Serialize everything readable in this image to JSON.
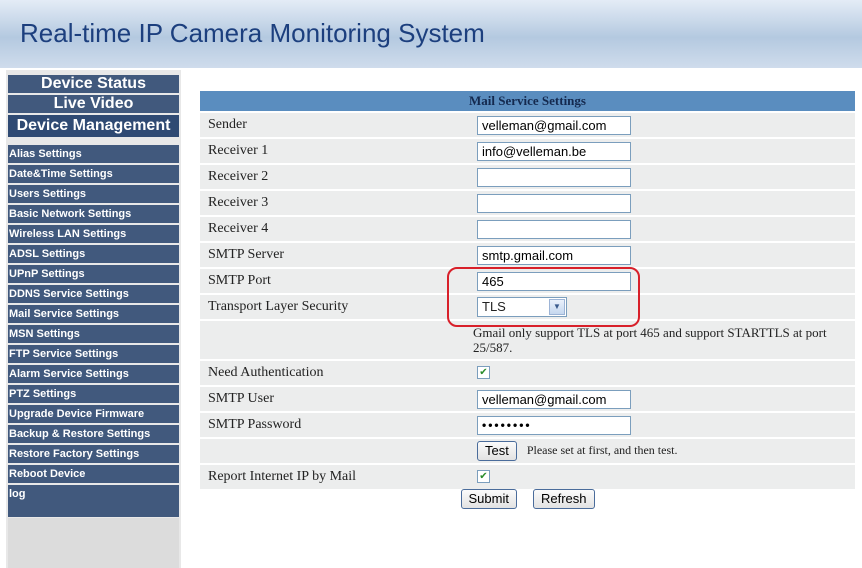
{
  "app_title": "Real-time IP Camera Monitoring System",
  "sidebar": {
    "top_items": [
      {
        "label": "Device Status"
      },
      {
        "label": "Live Video"
      },
      {
        "label": "Device Management"
      }
    ],
    "items": [
      {
        "label": "Alias Settings"
      },
      {
        "label": "Date&Time Settings"
      },
      {
        "label": "Users Settings"
      },
      {
        "label": "Basic Network Settings"
      },
      {
        "label": "Wireless LAN Settings"
      },
      {
        "label": "ADSL Settings"
      },
      {
        "label": "UPnP Settings"
      },
      {
        "label": "DDNS Service Settings"
      },
      {
        "label": "Mail Service Settings"
      },
      {
        "label": "MSN Settings"
      },
      {
        "label": "FTP Service Settings"
      },
      {
        "label": "Alarm Service Settings"
      },
      {
        "label": "PTZ Settings"
      },
      {
        "label": "Upgrade Device Firmware"
      },
      {
        "label": "Backup & Restore Settings"
      },
      {
        "label": "Restore Factory Settings"
      },
      {
        "label": "Reboot Device"
      },
      {
        "label": "log"
      }
    ]
  },
  "form": {
    "title": "Mail Service Settings",
    "sender": {
      "label": "Sender",
      "value": "velleman@gmail.com"
    },
    "receiver1": {
      "label": "Receiver 1",
      "value": "info@velleman.be"
    },
    "receiver2": {
      "label": "Receiver 2",
      "value": ""
    },
    "receiver3": {
      "label": "Receiver 3",
      "value": ""
    },
    "receiver4": {
      "label": "Receiver 4",
      "value": ""
    },
    "smtp_server": {
      "label": "SMTP Server",
      "value": "smtp.gmail.com"
    },
    "smtp_port": {
      "label": "SMTP Port",
      "value": "465"
    },
    "tls": {
      "label": "Transport Layer Security",
      "value": "TLS"
    },
    "gmail_note": "Gmail only support TLS at port 465 and support STARTTLS at port 25/587.",
    "need_auth": {
      "label": "Need Authentication",
      "checked": true
    },
    "smtp_user": {
      "label": "SMTP User",
      "value": "velleman@gmail.com"
    },
    "smtp_password": {
      "label": "SMTP Password",
      "value": "••••••••"
    },
    "test": {
      "label": "Test",
      "hint": "Please set at first, and then test."
    },
    "report_ip": {
      "label": "Report Internet IP by Mail",
      "checked": true
    },
    "submit_label": "Submit",
    "refresh_label": "Refresh"
  },
  "icons": {
    "check": "check-icon",
    "dropdown": "chevron-down-icon"
  },
  "colors": {
    "header_text": "#1c3f7e",
    "menu_bg": "#41597d",
    "table_header": "#5a8dbf",
    "highlight": "#d8202a"
  }
}
